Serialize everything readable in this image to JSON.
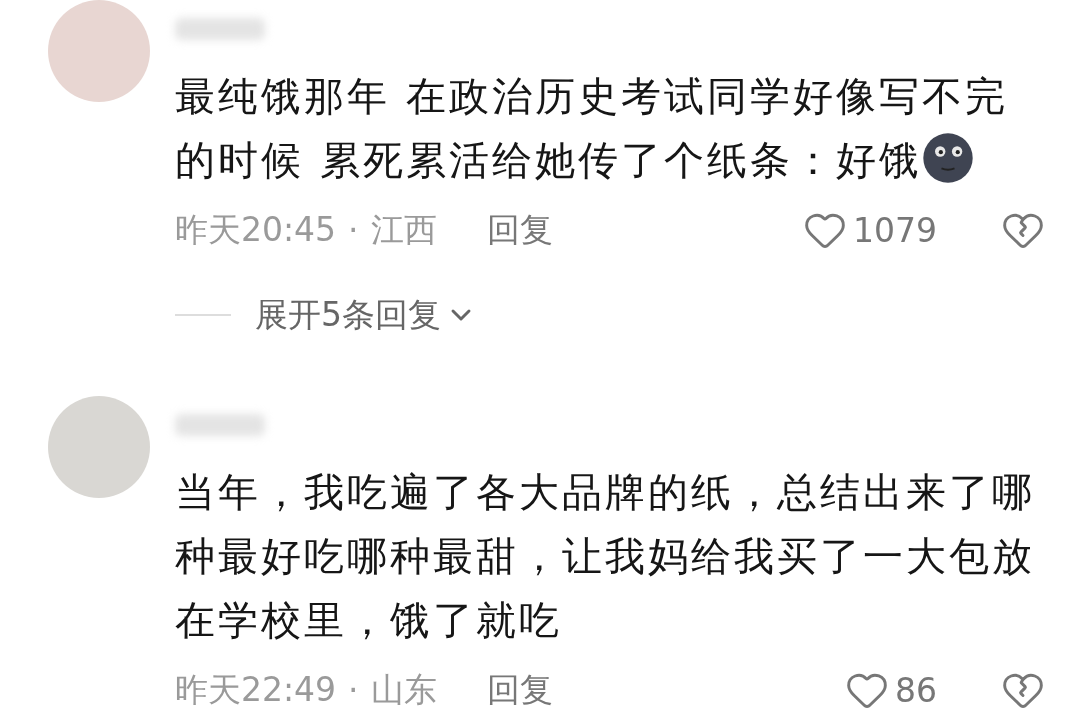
{
  "comments": [
    {
      "text": "最纯饿那年 在政治历史考试同学好像写不完的时候 累死累活给她传了个纸条：好饿",
      "trailing_emoji": true,
      "time": "昨天20:45",
      "separator": "·",
      "location": "江西",
      "reply": "回复",
      "likes": "1079",
      "replies_toggle": "展开5条回复"
    },
    {
      "text": "当年，我吃遍了各大品牌的纸，总结出来了哪种最好吃哪种最甜，让我妈给我买了一大包放在学校里，饿了就吃",
      "time": "昨天22:49",
      "separator": "·",
      "location": "山东",
      "reply": "回复",
      "likes": "86"
    }
  ]
}
